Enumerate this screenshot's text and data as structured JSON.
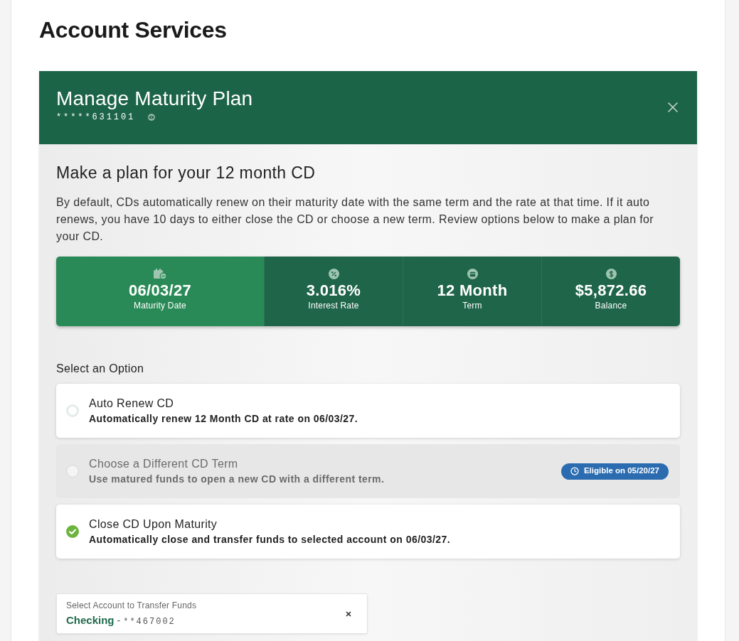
{
  "page_title": "Account Services",
  "modal": {
    "title": "Manage Maturity Plan",
    "account_number": "*****631101",
    "heading": "Make a plan for your 12 month CD",
    "description": "By default, CDs automatically renew on their maturity date with the same term and the rate at that time. If it auto renews, you have 10 days to either close the CD or choose a new term. Review options below to make a plan for your CD.",
    "summary": [
      {
        "kind": "date",
        "value": "06/03/27",
        "label": "Maturity Date",
        "highlighted": true
      },
      {
        "kind": "rate",
        "value": "3.016%",
        "label": "Interest Rate",
        "highlighted": false
      },
      {
        "kind": "term",
        "value": "12 Month",
        "label": "Term",
        "highlighted": false
      },
      {
        "kind": "balance",
        "value": "$5,872.66",
        "label": "Balance",
        "highlighted": false
      }
    ],
    "options_label": "Select an Option",
    "options": [
      {
        "title": "Auto Renew CD",
        "description": "Automatically renew 12 Month CD at rate on 06/03/27.",
        "selected": false,
        "disabled": false
      },
      {
        "title": "Choose a Different CD Term",
        "description": "Use matured funds to open a new CD with a different term.",
        "selected": false,
        "disabled": true,
        "badge": "Eligible on 05/20/27"
      },
      {
        "title": "Close CD Upon Maturity",
        "description": "Automatically close and transfer funds to selected account on 06/03/27.",
        "selected": true,
        "disabled": false
      }
    ],
    "transfer_field": {
      "label": "Select Account to Transfer Funds",
      "account_name": "Checking",
      "separator": "-",
      "account_number": "**467002"
    }
  }
}
